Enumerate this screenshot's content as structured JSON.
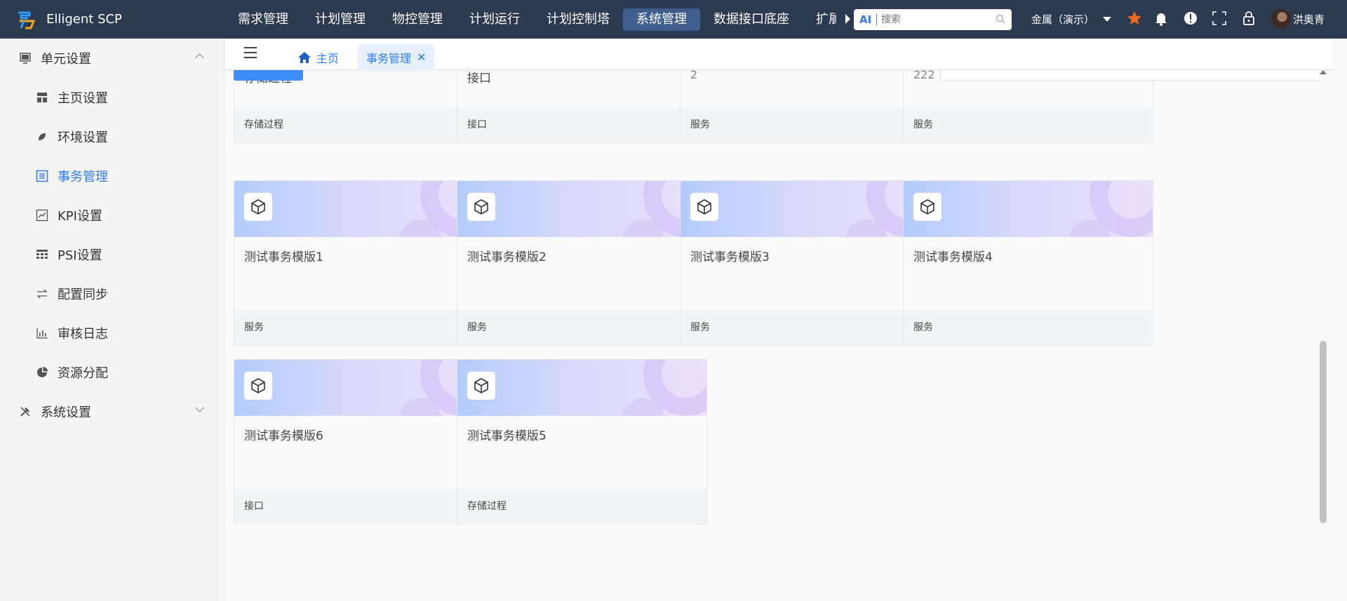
{
  "app": {
    "name": "Elligent SCP"
  },
  "top_nav": {
    "items": [
      "需求管理",
      "计划管理",
      "物控管理",
      "计划运行",
      "计划控制塔",
      "系统管理",
      "数据接口底座",
      "扩展"
    ],
    "active_index": 5
  },
  "search": {
    "ai_label": "AI",
    "placeholder": "搜索"
  },
  "tenant": {
    "label": "金属（演示）"
  },
  "user": {
    "name": "洪奥青"
  },
  "sidebar": {
    "group1": {
      "label": "单元设置",
      "expanded": true
    },
    "items": [
      {
        "label": "主页设置",
        "icon": "dashboard-icon"
      },
      {
        "label": "环境设置",
        "icon": "leaf-icon"
      },
      {
        "label": "事务管理",
        "icon": "list-icon",
        "active": true
      },
      {
        "label": "KPI设置",
        "icon": "line-chart-icon"
      },
      {
        "label": "PSI设置",
        "icon": "grid-icon"
      },
      {
        "label": "配置同步",
        "icon": "swap-icon"
      },
      {
        "label": "审核日志",
        "icon": "bar-chart-icon"
      },
      {
        "label": "资源分配",
        "icon": "pie-chart-icon"
      }
    ],
    "group2": {
      "label": "系统设置",
      "expanded": false
    }
  },
  "tabs": {
    "home": "主页",
    "current": "事务管理"
  },
  "cards_top_partial": [
    {
      "title": "存储过程",
      "sub": "",
      "type": "存储过程"
    },
    {
      "title": "接口",
      "sub": "",
      "type": "接口"
    },
    {
      "title": "",
      "sub": "2",
      "type": "服务"
    },
    {
      "title": "",
      "sub": "222",
      "type": "服务"
    }
  ],
  "cards": [
    {
      "title": "测试事务模版1",
      "type": "服务"
    },
    {
      "title": "测试事务模版2",
      "type": "服务"
    },
    {
      "title": "测试事务模版3",
      "type": "服务"
    },
    {
      "title": "测试事务模版4",
      "type": "服务"
    },
    {
      "title": "测试事务模版6",
      "type": "接口"
    },
    {
      "title": "测试事务模版5",
      "type": "存储过程"
    }
  ],
  "colors": {
    "topbar": "#2b3a4e",
    "accent": "#2d7cf6",
    "active_nav": "#3f5f8f"
  }
}
